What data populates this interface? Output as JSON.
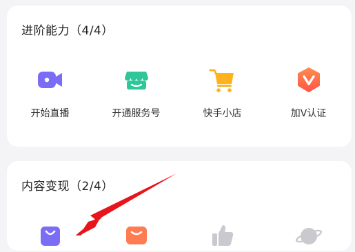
{
  "advanced": {
    "title": "进阶能力（4/4）",
    "items": [
      {
        "label": "开始直播",
        "icon": "video-camera-icon",
        "color": "#7b6cf6"
      },
      {
        "label": "开通服务号",
        "icon": "storefront-icon",
        "color": "#2ec79a"
      },
      {
        "label": "快手小店",
        "icon": "shopping-cart-icon",
        "color": "#ffb21c"
      },
      {
        "label": "加V认证",
        "icon": "verified-badge-icon",
        "color": "#ff6b4a"
      }
    ]
  },
  "monetize": {
    "title": "内容变现（2/4）",
    "items": [
      {
        "icon": "shopping-bag-icon",
        "color": "#7b6cf6"
      },
      {
        "icon": "coupon-icon",
        "color": "#ff7b52"
      },
      {
        "icon": "thumbs-up-icon",
        "color": "#c9c9cf"
      },
      {
        "icon": "planet-icon",
        "color": "#c9c9cf"
      }
    ]
  },
  "annotation": {
    "icon": "red-arrow-icon",
    "color": "#e8141b"
  }
}
